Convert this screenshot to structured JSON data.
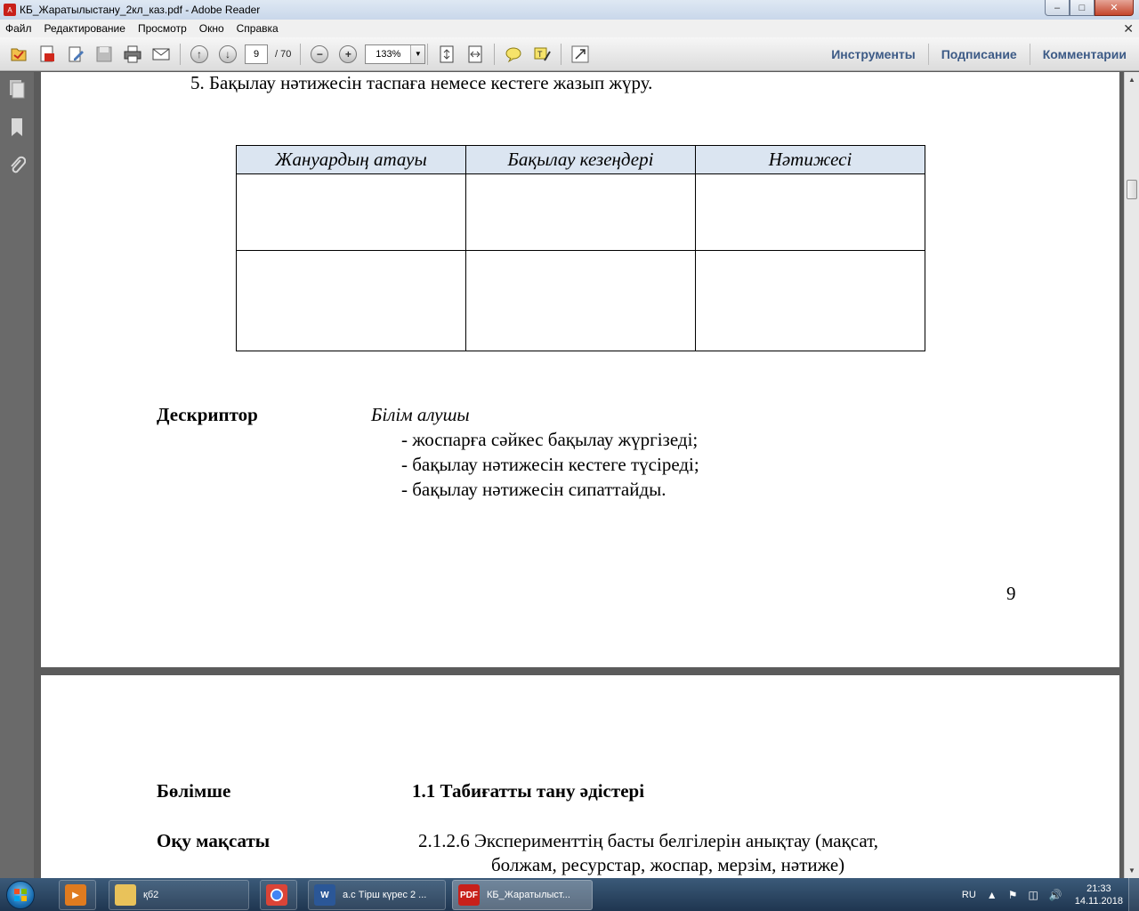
{
  "window": {
    "title": "КБ_Жаратылыстану_2кл_каз.pdf - Adobe Reader"
  },
  "menu": [
    "Файл",
    "Редактирование",
    "Просмотр",
    "Окно",
    "Справка"
  ],
  "toolbar": {
    "page_current": "9",
    "page_total": "/ 70",
    "zoom": "133%",
    "tools_label": "Инструменты",
    "sign_label": "Подписание",
    "comment_label": "Комментарии"
  },
  "page1": {
    "item5": "5.   Бақылау нәтижесін таспаға немесе кестеге жазып жүру.",
    "table_headers": [
      "Жануардың атауы",
      "Бақылау кезеңдері",
      "Нәтижесі"
    ],
    "descriptor_label": "Дескриптор",
    "descriptor_subject": "Білім алушы",
    "descriptor_lines": [
      "- жоспарға сәйкес бақылау жүргізеді;",
      "- бақылау нәтижесін кестеге түсіреді;",
      "- бақылау нәтижесін сипаттайды."
    ],
    "page_number": "9"
  },
  "page2": {
    "section_label": "Бөлімше",
    "section_value": "1.1 Табиғатты тану әдістері",
    "goal_label": "Оқу мақсаты",
    "goal_line1": "2.1.2.6 Эксперименттің басты белгілерін анықтау (мақсат,",
    "goal_line2": "болжам, ресурстар, жоспар, мерзім, нәтиже)"
  },
  "taskbar": {
    "apps": [
      {
        "label": "",
        "icon": "media-player-icon"
      },
      {
        "label": "қб2",
        "icon": "folder-icon"
      },
      {
        "label": "",
        "icon": "chrome-icon"
      },
      {
        "label": "а.с Тірш күрес 2 ...",
        "icon": "word-icon"
      },
      {
        "label": "КБ_Жаратылыст...",
        "icon": "pdf-icon"
      }
    ],
    "lang": "RU",
    "time": "21:33",
    "date": "14.11.2018"
  },
  "colors": {
    "toolbar_link": "#3c5a86",
    "table_header_bg": "#dbe5f1",
    "pdf_red": "#c8201a"
  }
}
